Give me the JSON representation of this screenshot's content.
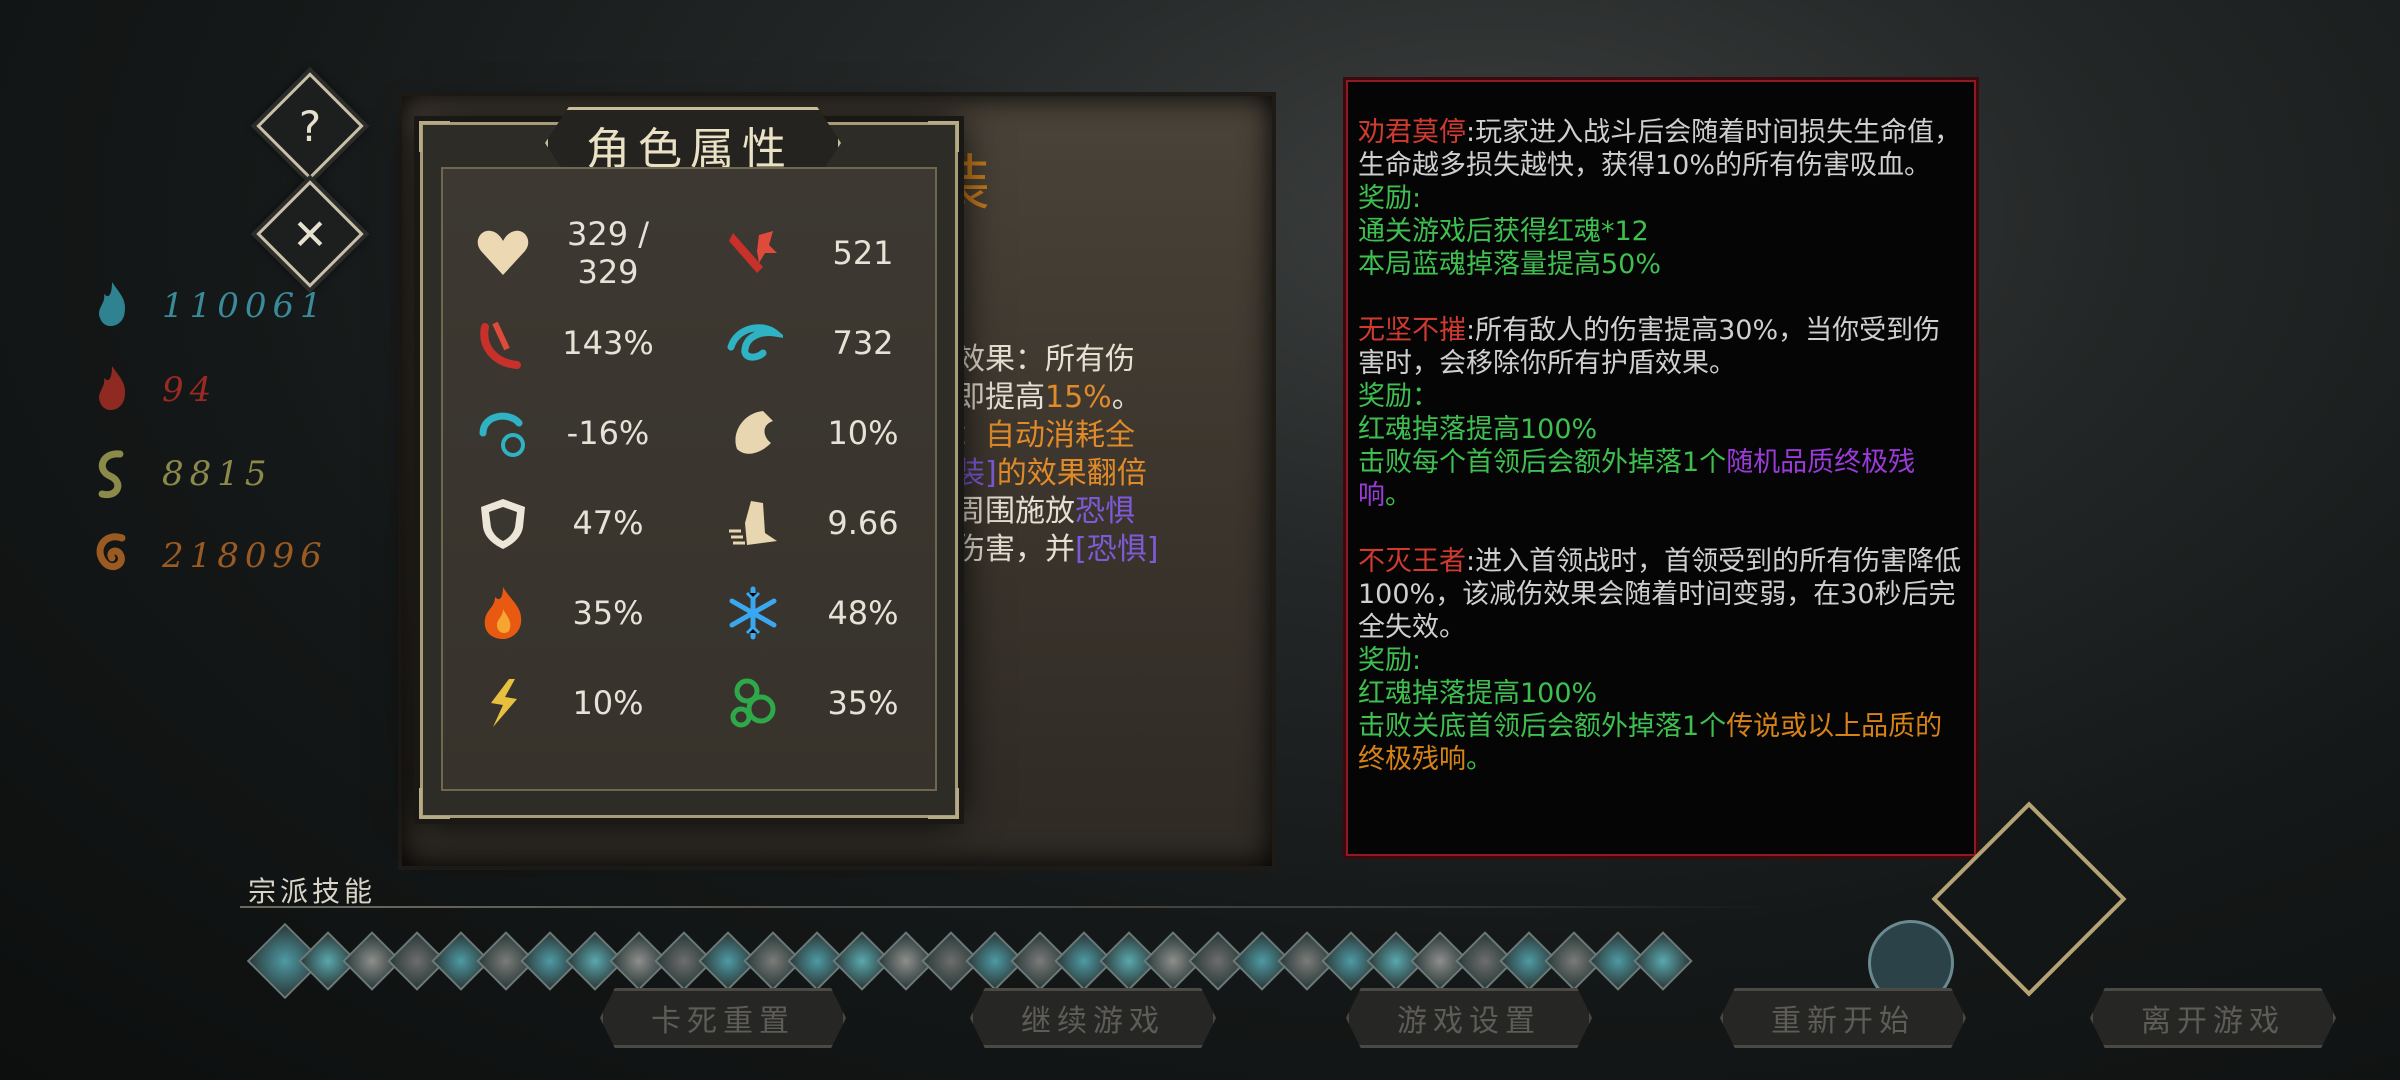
{
  "buttons": {
    "help": "?",
    "close": "✕"
  },
  "resources": [
    {
      "icon": "blue-soul-icon",
      "value": "110061",
      "color": "#3a8b9a"
    },
    {
      "icon": "red-soul-icon",
      "value": "94",
      "color": "#9a2a22"
    },
    {
      "icon": "green-soul-icon",
      "value": "8815",
      "color": "#8c8a4a"
    },
    {
      "icon": "orange-soul-icon",
      "value": "218096",
      "color": "#9a5a22"
    }
  ],
  "background_panel": {
    "title": "装",
    "lines": [
      {
        "a": "效果：所有伤",
        "b": "",
        "c": ""
      },
      {
        "a": "即提高",
        "b": "15%",
        "c": "。"
      },
      {
        "a": "：自动消耗全",
        "b": "",
        "c": ""
      },
      {
        "a": "装]",
        "b": "的效果翻倍",
        "c": ""
      },
      {
        "a": "周围施放",
        "b": "恐惧",
        "c": ""
      },
      {
        "a": "伤害，并",
        "b": "[恐惧]",
        "c": ""
      }
    ]
  },
  "attributes": {
    "title": "角色属性",
    "rows": [
      [
        {
          "icon": "heart-icon",
          "value": "329 / 329"
        },
        {
          "icon": "attack-icon",
          "value": "521"
        }
      ],
      [
        {
          "icon": "crit-rate-icon",
          "value": "143%"
        },
        {
          "icon": "crit-damage-icon",
          "value": "732"
        }
      ],
      [
        {
          "icon": "cooldown-icon",
          "value": "-16%"
        },
        {
          "icon": "dodge-icon",
          "value": "10%"
        }
      ],
      [
        {
          "icon": "shield-icon",
          "value": "47%"
        },
        {
          "icon": "speed-icon",
          "value": "9.66"
        }
      ],
      [
        {
          "icon": "fire-icon",
          "value": "35%"
        },
        {
          "icon": "frost-icon",
          "value": "48%"
        }
      ],
      [
        {
          "icon": "lightning-icon",
          "value": "10%"
        },
        {
          "icon": "poison-icon",
          "value": "35%"
        }
      ]
    ]
  },
  "info": {
    "entries": [
      {
        "name": "劝君莫停",
        "desc": ":玩家进入战斗后会随着时间损失生命值，生命越多损失越快，获得10%的所有伤害吸血。",
        "reward_label": "奖励:",
        "rewards": [
          [
            {
              "t": "通关游戏后获得红魂*12",
              "c": "green"
            }
          ],
          [
            {
              "t": "本局蓝魂掉落量提高50%",
              "c": "green"
            }
          ]
        ]
      },
      {
        "name": "无坚不摧",
        "desc": ":所有敌人的伤害提高30%，当你受到伤害时，会移除你所有护盾效果。",
        "reward_label": "奖励：",
        "rewards": [
          [
            {
              "t": "红魂掉落提高100%",
              "c": "green"
            }
          ],
          [
            {
              "t": "击败每个首领后会额外掉落1个",
              "c": "green"
            },
            {
              "t": "随机品质终极残响",
              "c": "purple"
            },
            {
              "t": "。",
              "c": "green"
            }
          ]
        ]
      },
      {
        "name": "不灭王者",
        "desc": ":进入首领战时，首领受到的所有伤害降低100%，该减伤效果会随着时间变弱，在30秒后完全失效。",
        "reward_label": "奖励:",
        "rewards": [
          [
            {
              "t": "红魂掉落提高100%",
              "c": "green"
            }
          ],
          [
            {
              "t": "击败关底首领后会额外掉落1个",
              "c": "green"
            },
            {
              "t": "传说或以上品质的终极残响",
              "c": "gold"
            },
            {
              "t": "。",
              "c": "green"
            }
          ]
        ]
      }
    ]
  },
  "skills": {
    "label": "宗派技能",
    "count": 32
  },
  "bottom_menu": [
    {
      "label": "卡死重置"
    },
    {
      "label": "继续游戏"
    },
    {
      "label": "游戏设置"
    },
    {
      "label": "重新开始"
    },
    {
      "label": "离开游戏"
    }
  ]
}
